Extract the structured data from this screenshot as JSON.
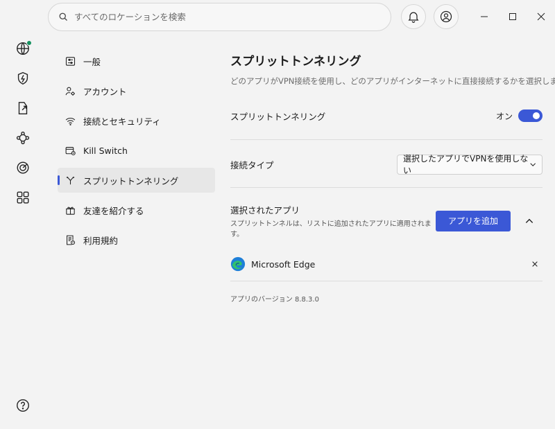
{
  "search": {
    "placeholder": "すべてのロケーションを検索"
  },
  "rail": {
    "items": [
      {
        "icon": "globe-icon",
        "status_color": "#14915f"
      },
      {
        "icon": "shield-bolt-icon"
      },
      {
        "icon": "file-share-icon"
      },
      {
        "icon": "meshnet-icon"
      },
      {
        "icon": "target-icon"
      },
      {
        "icon": "apps-grid-icon"
      }
    ],
    "help_icon": "help-icon"
  },
  "nav": {
    "items": [
      {
        "label": "一般",
        "icon": "sliders-icon"
      },
      {
        "label": "アカウント",
        "icon": "account-gear-icon"
      },
      {
        "label": "接続とセキュリティ",
        "icon": "wifi-icon"
      },
      {
        "label": "Kill Switch",
        "icon": "kill-switch-icon"
      },
      {
        "label": "スプリットトンネリング",
        "icon": "split-icon",
        "active": true
      },
      {
        "label": "友達を紹介する",
        "icon": "gift-icon"
      },
      {
        "label": "利用規約",
        "icon": "terms-icon"
      }
    ]
  },
  "main": {
    "title": "スプリットトンネリング",
    "description": "どのアプリがVPN接続を使用し、どのアプリがインターネットに直接接続するかを選択します。",
    "split_tunneling": {
      "label": "スプリットトンネリング",
      "state_label": "オン",
      "enabled": true
    },
    "connection_type": {
      "label": "接続タイプ",
      "selected": "選択したアプリでVPNを使用しない"
    },
    "selected_apps": {
      "label": "選択されたアプリ",
      "sublabel": "スプリットトンネルは、リストに追加されたアプリに適用されます。",
      "add_button": "アプリを追加",
      "apps": [
        {
          "name": "Microsoft Edge",
          "icon": "edge-icon"
        }
      ]
    },
    "version": "アプリのバージョン 8.8.3.0"
  },
  "colors": {
    "accent": "#3b58d6",
    "status_green": "#14915f"
  }
}
